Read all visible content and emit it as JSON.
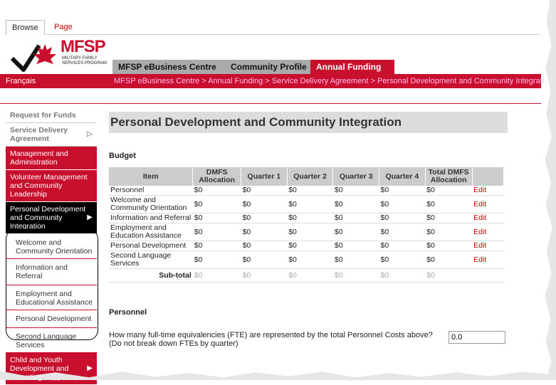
{
  "browser_tabs": {
    "browse": "Browse",
    "page": "Page"
  },
  "logo": {
    "name": "MFSP",
    "subtitle": "MILITARY FAMILY SERVICES PROGRAM"
  },
  "nav_tabs": [
    "MFSP eBusiness Centre",
    "Community Profile",
    "Annual Funding"
  ],
  "language_link": "Français",
  "breadcrumb": "MFSP eBusiness Centre > Annual Funding > Service Delivery Agreement > Personal Development and Community Integrati",
  "sidebar": {
    "request_for_funds": "Request for Funds",
    "service_delivery": "Service Delivery Agreement",
    "management": "Management and Administration",
    "volunteer": "Volunteer Management and Community Leadership",
    "personal_dev": "Personal Development and Community Integration",
    "sub_items": [
      "Welcome and Community Orientation",
      "Information and Referral",
      "Employment and Educational Assistance",
      "Personal Development",
      "Second Language Services"
    ],
    "child_youth": "Child and Youth Development and Parenting Support"
  },
  "main": {
    "title": "Personal Development and Community Integration",
    "budget_label": "Budget",
    "columns": [
      "Item",
      "DMFS Allocation",
      "Quarter 1",
      "Quarter 2",
      "Quarter 3",
      "Quarter 4",
      "Total DMFS Allocation",
      ""
    ],
    "rows": [
      {
        "item": "Personnel",
        "dmfs": "$0",
        "q1": "$0",
        "q2": "$0",
        "q3": "$0",
        "q4": "$0",
        "total": "$0",
        "action": "Edit"
      },
      {
        "item": "Welcome and Community Orientation",
        "dmfs": "$0",
        "q1": "$0",
        "q2": "$0",
        "q3": "$0",
        "q4": "$0",
        "total": "$0",
        "action": "Edit"
      },
      {
        "item": "Information and Referral",
        "dmfs": "$0",
        "q1": "$0",
        "q2": "$0",
        "q3": "$0",
        "q4": "$0",
        "total": "$0",
        "action": "Edit"
      },
      {
        "item": "Employment and Education Assistance",
        "dmfs": "$0",
        "q1": "$0",
        "q2": "$0",
        "q3": "$0",
        "q4": "$0",
        "total": "$0",
        "action": "Edit"
      },
      {
        "item": "Personal Development",
        "dmfs": "$0",
        "q1": "$0",
        "q2": "$0",
        "q3": "$0",
        "q4": "$0",
        "total": "$0",
        "action": "Edit"
      },
      {
        "item": "Second Language Services",
        "dmfs": "$0",
        "q1": "$0",
        "q2": "$0",
        "q3": "$0",
        "q4": "$0",
        "total": "$0",
        "action": "Edit"
      }
    ],
    "subtotal": {
      "label": "Sub-total",
      "dmfs": "$0",
      "q1": "$0",
      "q2": "$0",
      "q3": "$0",
      "q4": "$0",
      "total": "$0"
    },
    "personnel_label": "Personnel",
    "fte_question_line1": "How many full-time equivalencies (FTE) are represented by the total Personnel Costs above?",
    "fte_question_line2": "(Do not break down FTEs by quarter)",
    "fte_value": "0.0"
  },
  "colors": {
    "accent": "#c8102e",
    "nav_gray": "#aaaaaa"
  }
}
